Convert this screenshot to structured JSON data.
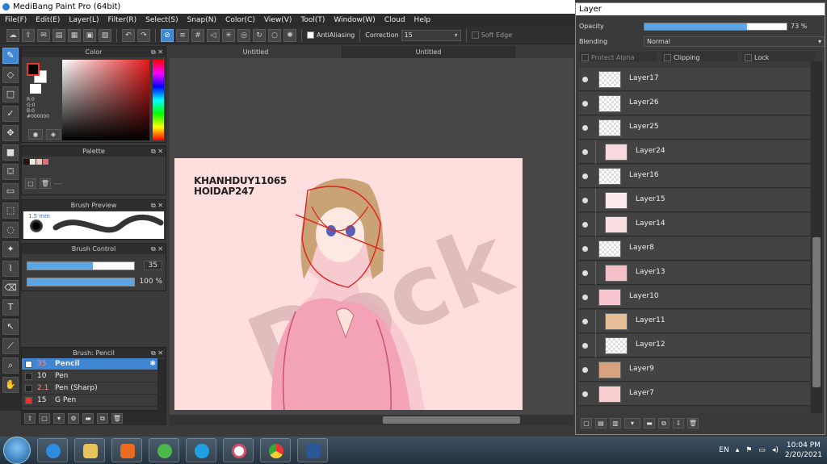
{
  "window": {
    "title": "MediBang Paint Pro (64bit)"
  },
  "menu": [
    "File(F)",
    "Edit(E)",
    "Layer(L)",
    "Filter(R)",
    "Select(S)",
    "Snap(N)",
    "Color(C)",
    "View(V)",
    "Tool(T)",
    "Window(W)",
    "Cloud",
    "Help"
  ],
  "toolbar": {
    "antialiasing_label": "AntiAliasing",
    "correction_label": "Correction",
    "correction_value": "15",
    "soft_edge_label": "Soft Edge"
  },
  "panels": {
    "color": {
      "title": "Color",
      "r": "R:0",
      "g": "G:0",
      "b": "B:0",
      "hex": "#000000",
      "fg": "#000000",
      "bg": "#ffffff"
    },
    "palette": {
      "title": "Palette",
      "swatches": [
        "#2a1010",
        "#f0e8e0",
        "#f4c8b0",
        "#e86a6a"
      ],
      "ellipsis": "---"
    },
    "brush_preview": {
      "title": "Brush Preview",
      "size_label": "1.5 mm"
    },
    "brush_control": {
      "title": "Brush Control",
      "size": "35",
      "opacity": "100 %"
    },
    "brush_list": {
      "title": "Brush: Pencil",
      "items": [
        {
          "size": "35",
          "name": "Pencil",
          "color": "#ffffff",
          "selected": true
        },
        {
          "size": "10",
          "name": "Pen",
          "color": "#222222",
          "selected": false
        },
        {
          "size": "2.1",
          "name": "Pen (Sharp)",
          "color": "#222222",
          "selected": false
        },
        {
          "size": "15",
          "name": "G Pen",
          "color": "#e83030",
          "selected": false
        }
      ]
    }
  },
  "document": {
    "tabs": [
      "Untitled",
      "Untitled"
    ],
    "canvas_handle_line1": "KHANHDUY11065",
    "canvas_handle_line2": "HOIDAP247",
    "watermark": "Dock"
  },
  "layer_window": {
    "title": "Layer",
    "opacity_label": "Opacity",
    "opacity_value": "73 %",
    "opacity_fraction": 0.72,
    "blending_label": "Blending",
    "blending_value": "Normal",
    "protect_alpha_label": "Protect Alpha",
    "clipping_label": "Clipping",
    "lock_label": "Lock",
    "layers": [
      {
        "name": "Layer17",
        "indent": false
      },
      {
        "name": "Layer26",
        "indent": false
      },
      {
        "name": "Layer25",
        "indent": false
      },
      {
        "name": "Layer24",
        "indent": true
      },
      {
        "name": "Layer16",
        "indent": false
      },
      {
        "name": "Layer15",
        "indent": true
      },
      {
        "name": "Layer14",
        "indent": true
      },
      {
        "name": "Layer8",
        "indent": false
      },
      {
        "name": "Layer13",
        "indent": true
      },
      {
        "name": "Layer10",
        "indent": false
      },
      {
        "name": "Layer11",
        "indent": true
      },
      {
        "name": "Layer12",
        "indent": true
      },
      {
        "name": "Layer9",
        "indent": false
      },
      {
        "name": "Layer7",
        "indent": false
      }
    ]
  },
  "taskbar": {
    "language": "EN",
    "time": "10:04 PM",
    "date": "2/20/2021"
  }
}
